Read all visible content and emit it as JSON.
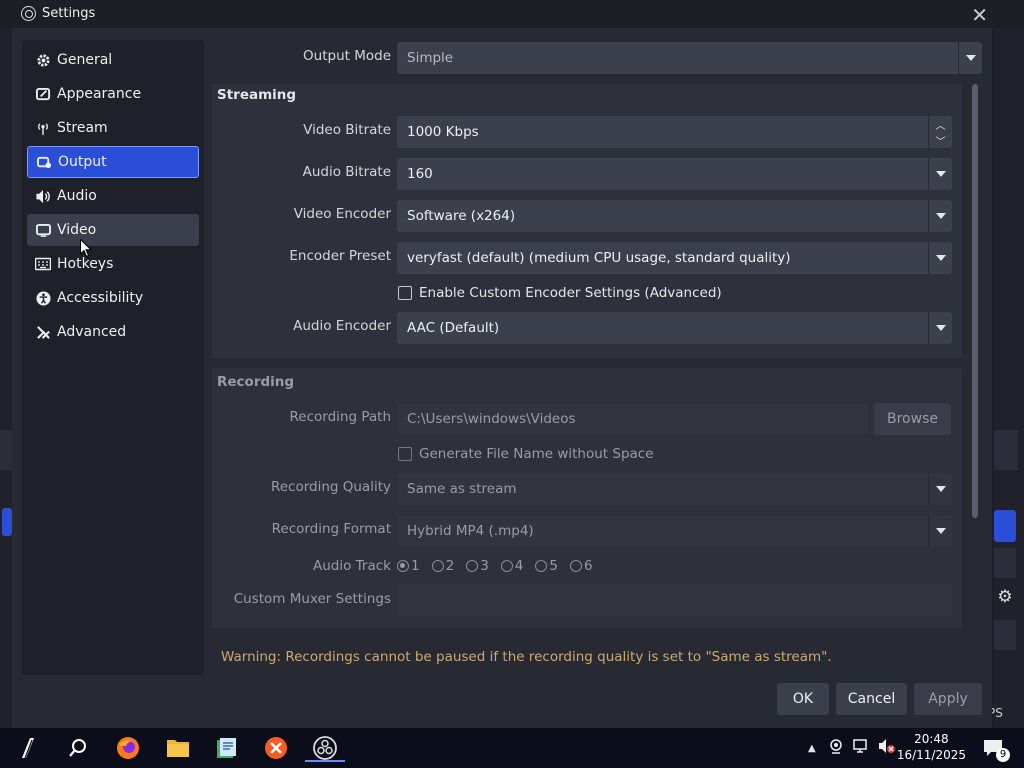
{
  "window": {
    "title": "Settings"
  },
  "sidebar": {
    "items": [
      {
        "label": "General",
        "icon": "gear-icon"
      },
      {
        "label": "Appearance",
        "icon": "palette-icon"
      },
      {
        "label": "Stream",
        "icon": "antenna-icon"
      },
      {
        "label": "Output",
        "icon": "output-icon",
        "active": true
      },
      {
        "label": "Audio",
        "icon": "speaker-icon"
      },
      {
        "label": "Video",
        "icon": "monitor-icon"
      },
      {
        "label": "Hotkeys",
        "icon": "keyboard-icon"
      },
      {
        "label": "Accessibility",
        "icon": "accessibility-icon"
      },
      {
        "label": "Advanced",
        "icon": "wrench-icon"
      }
    ]
  },
  "output_mode": {
    "label": "Output Mode",
    "value": "Simple"
  },
  "streaming": {
    "title": "Streaming",
    "video_bitrate": {
      "label": "Video Bitrate",
      "value": "1000 Kbps"
    },
    "audio_bitrate": {
      "label": "Audio Bitrate",
      "value": "160"
    },
    "video_encoder": {
      "label": "Video Encoder",
      "value": "Software (x264)"
    },
    "encoder_preset": {
      "label": "Encoder Preset",
      "value": "veryfast (default) (medium CPU usage, standard quality)"
    },
    "custom_encoder": {
      "label": "Enable Custom Encoder Settings (Advanced)",
      "checked": false
    },
    "audio_encoder": {
      "label": "Audio Encoder",
      "value": "AAC (Default)"
    }
  },
  "recording": {
    "title": "Recording",
    "path": {
      "label": "Recording Path",
      "value": "C:\\Users\\windows\\Videos",
      "browse": "Browse"
    },
    "no_space": {
      "label": "Generate File Name without Space",
      "checked": false
    },
    "quality": {
      "label": "Recording Quality",
      "value": "Same as stream"
    },
    "format": {
      "label": "Recording Format",
      "value": "Hybrid MP4 (.mp4)"
    },
    "audio_track": {
      "label": "Audio Track",
      "options": [
        "1",
        "2",
        "3",
        "4",
        "5",
        "6"
      ],
      "selected": "1"
    },
    "muxer": {
      "label": "Custom Muxer Settings",
      "value": ""
    }
  },
  "warning": "Warning: Recordings cannot be paused if the recording quality is set to \"Same as stream\".",
  "buttons": {
    "ok": "OK",
    "cancel": "Cancel",
    "apply": "Apply"
  },
  "taskbar": {
    "time": "20:48",
    "date": "16/11/2025",
    "notification_count": "9",
    "background_text": "PS"
  },
  "colors": {
    "accent": "#2a4ed8",
    "warning": "#d2a86a",
    "dialog_bg": "#272a33"
  }
}
